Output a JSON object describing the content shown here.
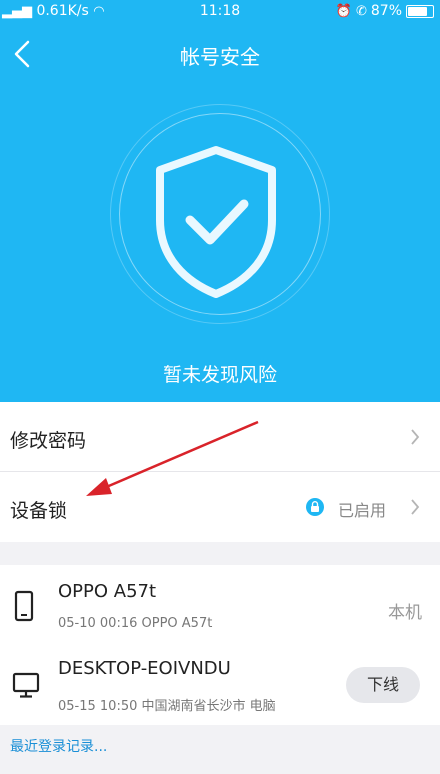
{
  "status_bar": {
    "network_speed": "0.61K/s",
    "time": "11:18",
    "battery_percent": "87%",
    "battery_level": 0.87
  },
  "header": {
    "title": "帐号安全",
    "status_message": "暂未发现风险",
    "background_color": "#1fb7f3"
  },
  "settings": {
    "change_password_label": "修改密码",
    "device_lock_label": "设备锁",
    "device_lock_status": "已启用"
  },
  "devices": [
    {
      "name": "OPPO A57t",
      "detail": "05-10 00:16 OPPO A57t",
      "tag": "本机",
      "icon": "phone-icon"
    },
    {
      "name": "DESKTOP-EOIVNDU",
      "detail": "05-15 10:50 中国湖南省长沙市 电脑",
      "action": "下线",
      "icon": "monitor-icon"
    }
  ],
  "footer": {
    "recent_login_link": "最近登录记录..."
  }
}
